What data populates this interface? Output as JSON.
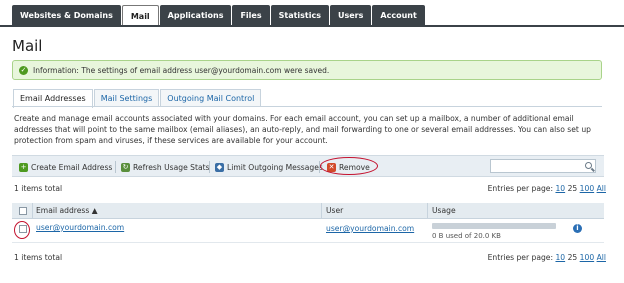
{
  "top_tabs": [
    "Websites & Domains",
    "Mail",
    "Applications",
    "Files",
    "Statistics",
    "Users",
    "Account"
  ],
  "active_top_tab": "Mail",
  "page_title": "Mail",
  "message": {
    "text": "Information: The settings of email address user@yourdomain.com were saved."
  },
  "sub_tabs": [
    "Email Addresses",
    "Mail Settings",
    "Outgoing Mail Control"
  ],
  "active_sub_tab": "Email Addresses",
  "description": "Create and manage email accounts associated with your domains. For each email account, you can set up a mailbox, a number of additional email addresses that will point to the same mailbox (email aliases), an auto-reply, and mail forwarding to one or several email addresses. You can also set up protection from spam and viruses, if these services are available for your account.",
  "toolbar": {
    "create_label": "Create Email Address",
    "refresh_label": "Refresh Usage Stats",
    "limit_label": "Limit Outgoing Messages",
    "remove_label": "Remove",
    "search_placeholder": ""
  },
  "list": {
    "total_text": "1 items total",
    "entries_label": "Entries per page:",
    "page_sizes": [
      "10",
      "25",
      "100",
      "All"
    ],
    "selected_page_size": "25"
  },
  "table": {
    "columns": {
      "email": "Email address ▲",
      "user": "User",
      "usage": "Usage"
    },
    "rows": [
      {
        "email": "user@yourdomain.com",
        "user": "user@yourdomain.com",
        "usage_text": "0 B used of 20.0 KB",
        "usage_fraction": 0
      }
    ]
  },
  "colors": {
    "tab_bg": "#3b4248",
    "link": "#1c66a7",
    "highlight_oval": "#c4122f",
    "success_bg": "#e8f6dc"
  },
  "icons": {
    "create": "add-mail-icon",
    "refresh": "refresh-icon",
    "limit": "shield-icon",
    "remove": "remove-x-icon",
    "search": "search-icon",
    "info": "info-icon",
    "success": "check-icon"
  }
}
